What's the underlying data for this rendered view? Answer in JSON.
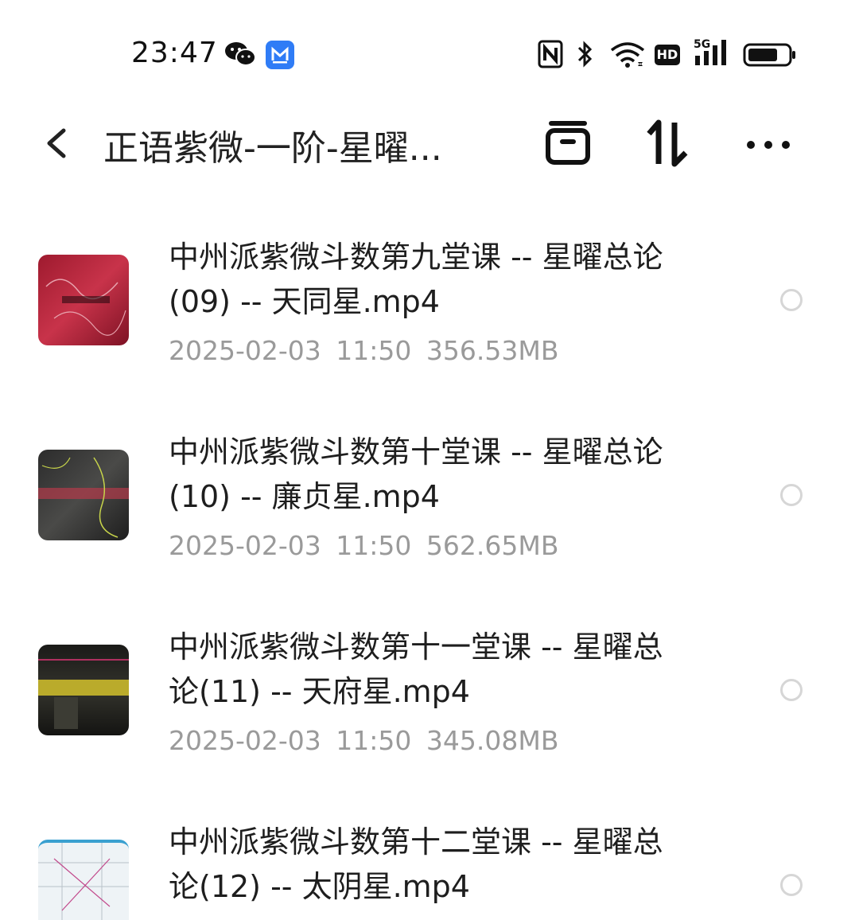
{
  "status_bar": {
    "time": "23:47",
    "left_icons": [
      "wechat-icon",
      "mail-app-icon"
    ],
    "right_icons": [
      "nfc-icon",
      "bluetooth-icon",
      "wifi-icon",
      "hd-icon",
      "5g-signal-icon",
      "battery-icon"
    ],
    "hd_label": "HD",
    "network_label": "5G"
  },
  "header": {
    "title": "正语紫微-一阶-星曜...",
    "actions": [
      "archive-icon",
      "sort-icon",
      "more-icon"
    ]
  },
  "files": [
    {
      "name_line1": "中州派紫微斗数第九堂课 -- 星曜总论",
      "name_line2": "(09) -- 天同星.mp4",
      "date": "2025-02-03",
      "time": "11:50",
      "size": "356.53MB",
      "thumb_color": "#b8243a"
    },
    {
      "name_line1": "中州派紫微斗数第十堂课 -- 星曜总论",
      "name_line2": "(10) -- 廉贞星.mp4",
      "date": "2025-02-03",
      "time": "11:50",
      "size": "562.65MB",
      "thumb_color": "#3a3a3a"
    },
    {
      "name_line1": "中州派紫微斗数第十一堂课 -- 星曜总",
      "name_line2": "论(11) -- 天府星.mp4",
      "date": "2025-02-03",
      "time": "11:50",
      "size": "345.08MB",
      "thumb_color": "#2a2a22"
    },
    {
      "name_line1": "中州派紫微斗数第十二堂课 -- 星曜总",
      "name_line2": "论(12) -- 太阴星.mp4",
      "date": "",
      "time": "",
      "size": "",
      "thumb_color": "#e8f0f4"
    }
  ]
}
